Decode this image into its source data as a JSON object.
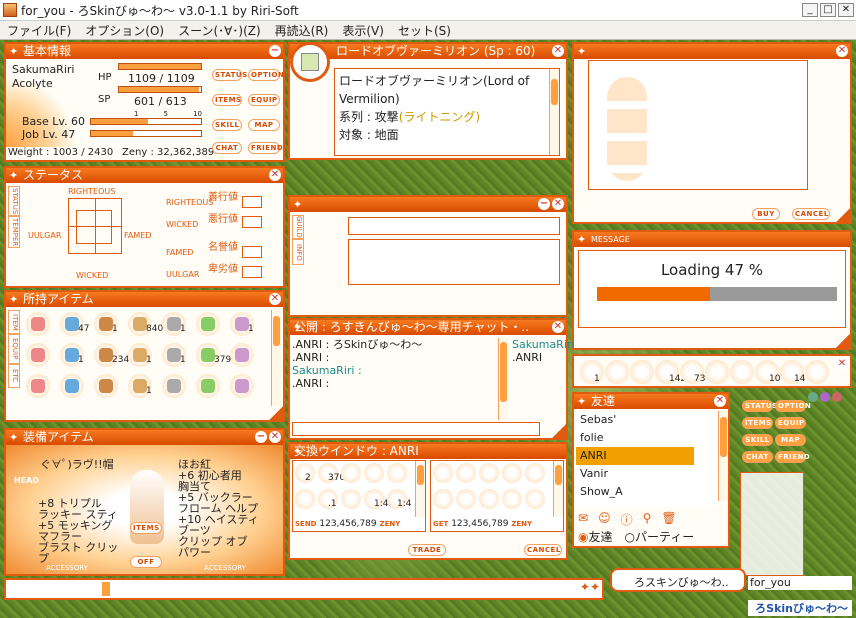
{
  "window": {
    "title": "for_you - ろSkinびゅ〜わ〜 v3.0-1.1 by Riri-Soft",
    "min": "_",
    "max": "□",
    "close": "✕"
  },
  "menu": [
    "ファイル(F)",
    "オプション(O)",
    "スーン(･∀･)(Z)",
    "再読込(R)",
    "表示(V)",
    "セット(S)"
  ],
  "basic": {
    "title": "基本情報",
    "name": "SakumaRiri",
    "job": "Acolyte",
    "hp_label": "HP",
    "hp": "1109 / 1109",
    "hp_fill": 1.0,
    "sp_label": "SP",
    "sp": "601 / 613",
    "sp_fill": 0.98,
    "base_lv": "Base Lv. 60",
    "job_lv": "Job Lv. 47",
    "ticks": [
      "1",
      "5",
      "10"
    ],
    "weight": "Weight : 1003 / 2430",
    "zeny": "Zeny : 32,362,389",
    "buttons": [
      "STATUS",
      "OPTION",
      "ITEMS",
      "EQUIP",
      "SKILL",
      "MAP",
      "CHAT",
      "FRIEND"
    ]
  },
  "skill": {
    "title": "ロードオブヴァーミリオン (Sp : 60)",
    "l1": "ロードオブヴァーミリオン(Lord of",
    "l2": "Vermilion)",
    "l3a": "系列 : 攻撃",
    "l3b": "(ライトニング)",
    "l4": "対象 : 地面"
  },
  "status": {
    "title": "ステータス",
    "tab1": "STATUS",
    "tab2": "TEMPER",
    "top": "RIGHTEOUS",
    "bottom": "WICKED",
    "left": "UULGAR",
    "right": "FAMED",
    "rows": [
      {
        "en": "RIGHTEOUS",
        "jp": "善行値"
      },
      {
        "en": "WICKED",
        "jp": "悪行値"
      },
      {
        "en": "FAMED",
        "jp": "名誉値"
      },
      {
        "en": "UULGAR",
        "jp": "卑劣値"
      }
    ]
  },
  "info": {
    "tab1": "GUILD",
    "tab2": "INFO"
  },
  "message": {
    "title": "MESSAGE",
    "text": "Loading 47 %",
    "progress": 0.47
  },
  "shop": {
    "buy": "BUY",
    "cancel": "CANCEL"
  },
  "items": {
    "title": "所持アイテム",
    "tabs": [
      "ITEM",
      "EQUIP",
      "ETC"
    ],
    "counts": [
      "",
      "47",
      "1",
      "8406",
      "1",
      "",
      "1",
      "",
      "1",
      "2346",
      "1",
      "1",
      "379",
      "",
      "",
      "",
      "",
      "1",
      "",
      "",
      ""
    ]
  },
  "chat": {
    "title": "公開 : ろすきんびゅ〜わ〜専用チャット・..",
    "lines": [
      {
        "who": ".ANRI",
        "text": " : ろSkinびゅ〜わ〜",
        "c": "#222"
      },
      {
        "who": ".ANRI",
        "text": " :",
        "c": "#222"
      },
      {
        "who": "SakumaRiri",
        "text": " :",
        "c": "#1a8a8a"
      },
      {
        "who": ".ANRI",
        "text": " :",
        "c": "#222"
      }
    ],
    "members": [
      "SakumaRiri",
      ".ANRI"
    ]
  },
  "equip": {
    "title": "装備アイテム",
    "top_left": "ぐ∀ﾟ)ラヴ!!帽",
    "top_right": "ほお紅",
    "left": [
      "+8 トリプル",
      "ラッキー スティ",
      "+5 モッキング",
      "マフラー",
      "ブラスト クリッ",
      "プ"
    ],
    "right": [
      "+6 初心者用",
      "胸当て",
      "+5 バックラー",
      "フローム ヘルプ",
      "+10 ヘイスティ",
      "ブーツ",
      "クリップ オブ",
      "パワー"
    ],
    "items_btn": "ITEMS",
    "off_btn": "OFF",
    "head": "HEAD",
    "acc": "ACCESSORY"
  },
  "trade": {
    "title": "交換ウインドウ : ANRI",
    "send": "SEND",
    "send_zeny": "123,456,789",
    "get": "GET",
    "get_zeny": "123,456,789",
    "zeny": "ZENY",
    "trade_btn": "TRADE",
    "cancel_btn": "CANCEL",
    "send_counts": [
      "2",
      "370",
      "",
      "",
      "",
      "",
      ".1",
      "",
      "1:42",
      "1:4"
    ]
  },
  "hotbar": {
    "counts": [
      "1",
      "",
      "",
      "142",
      "73",
      "",
      "",
      "10",
      "14",
      ""
    ]
  },
  "friends": {
    "title": "友達",
    "list": [
      "Sebas'",
      "folie",
      "ANRI",
      "Vanir",
      "Show_A"
    ],
    "selected": 2,
    "radio1": "友達",
    "radio2": "パーティー"
  },
  "mini": {
    "buttons": [
      "STATUS",
      "OPTION",
      "ITEMS",
      "EQUIP",
      "SKILL",
      "MAP",
      "CHAT",
      "FRIEND"
    ]
  },
  "bubble": "ろスキンびゅ〜わ..",
  "player_name": "for_you",
  "logo": "ろSkinびゅ〜わ〜",
  "colors": {
    "accent": "#e05a10",
    "fill": "#ffa040"
  }
}
